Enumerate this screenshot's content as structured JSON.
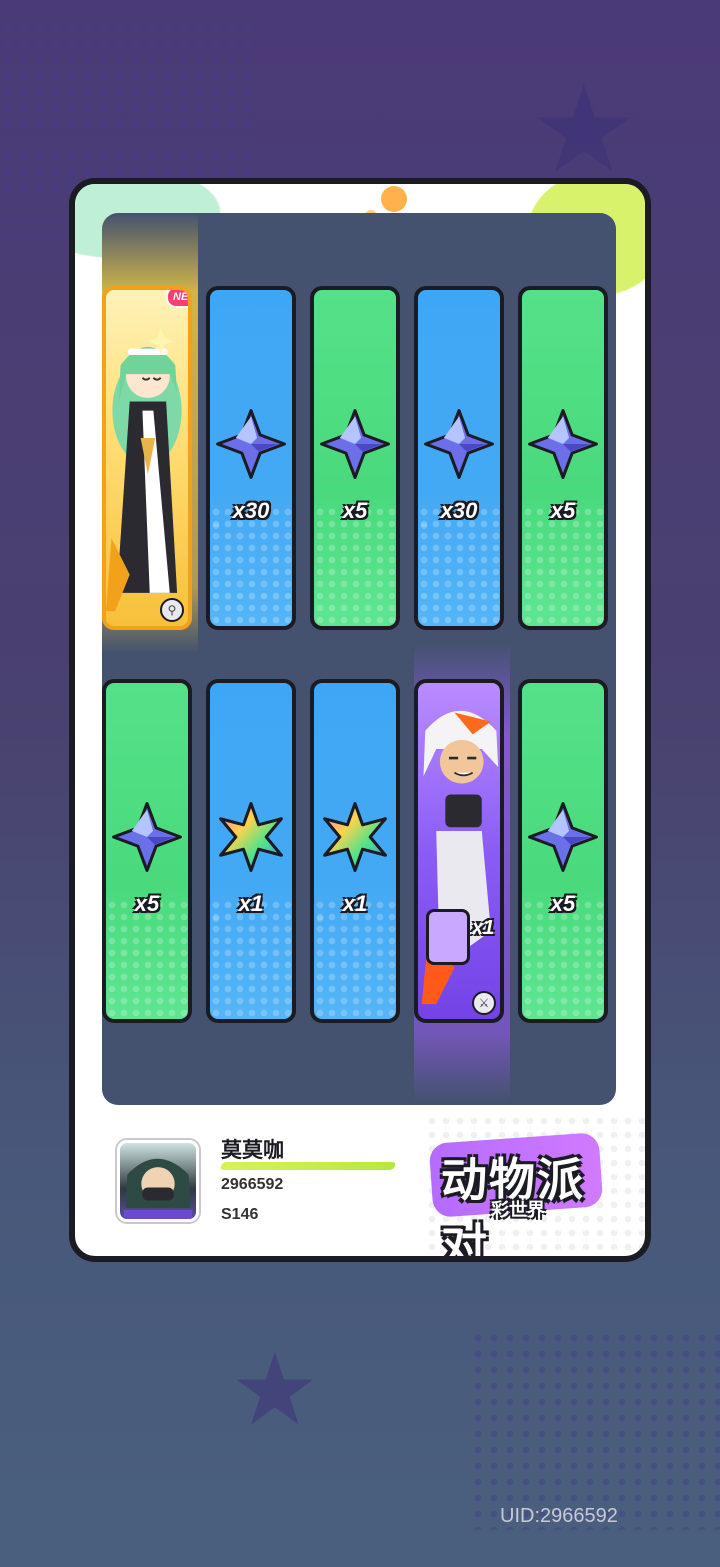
{
  "background": {
    "star_icon": "star-outline",
    "uid_label": "UID:2966592"
  },
  "result_card": {
    "rows": [
      [
        {
          "kind": "character",
          "rarity": "gold",
          "badge": "NEW",
          "corner_icon": "key-icon"
        },
        {
          "kind": "item",
          "color": "blue",
          "icon": "blue-star-crystal",
          "qty": "x30"
        },
        {
          "kind": "item",
          "color": "green",
          "icon": "blue-star-crystal",
          "qty": "x5"
        },
        {
          "kind": "item",
          "color": "blue",
          "icon": "blue-star-crystal",
          "qty": "x30"
        },
        {
          "kind": "item",
          "color": "green",
          "icon": "blue-star-crystal",
          "qty": "x5"
        }
      ],
      [
        {
          "kind": "item",
          "color": "green",
          "icon": "blue-star-crystal",
          "qty": "x5"
        },
        {
          "kind": "item",
          "color": "blue",
          "icon": "rainbow-star-crystal",
          "qty": "x1"
        },
        {
          "kind": "item",
          "color": "blue",
          "icon": "rainbow-star-crystal",
          "qty": "x1"
        },
        {
          "kind": "character",
          "rarity": "purple",
          "qty": "x1",
          "corner_icon": "sword-icon"
        },
        {
          "kind": "item",
          "color": "green",
          "icon": "blue-star-crystal",
          "qty": "x5"
        }
      ]
    ]
  },
  "player": {
    "name": "莫莫咖",
    "id": "2966592",
    "server": "S146"
  },
  "logo": {
    "main": "动物派对",
    "sub": "彩世界"
  },
  "colors": {
    "blue_slot": "#44a9f4",
    "green_slot": "#49da7c",
    "panel": "#44526f",
    "gold_glow": "#ffd63c",
    "purple_glow": "#a05aff"
  }
}
